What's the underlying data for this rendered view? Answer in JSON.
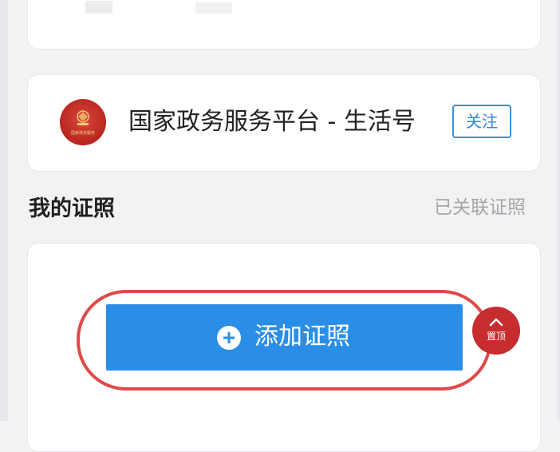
{
  "service": {
    "name": "国家政务服务平台 - 生活号",
    "emblem_caption": "国家政务服务",
    "follow_label": "关注"
  },
  "licenses": {
    "section_title": "我的证照",
    "linked_link": "已关联证照",
    "add_button_label": "添加证照"
  },
  "floating": {
    "to_top_label": "置顶"
  },
  "colors": {
    "primary_blue": "#2a8ee6",
    "highlight_red": "#e04949",
    "emblem_red": "#b8261f",
    "link_gray": "#a5a6a8"
  },
  "icons": {
    "plus": "plus-circle-icon",
    "emblem": "national-emblem-icon",
    "to_top": "arrow-up-icon"
  }
}
